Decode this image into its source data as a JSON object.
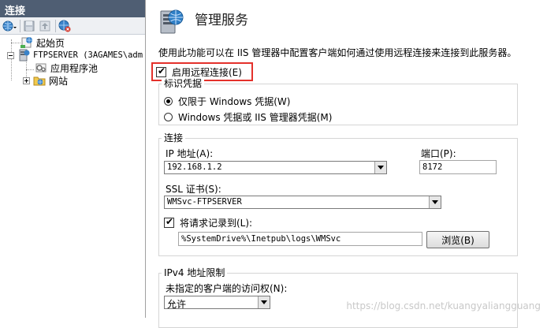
{
  "left": {
    "header": "连接",
    "tree": [
      {
        "label": "起始页"
      },
      {
        "label": "FTPSERVER (3AGAMES\\adm"
      },
      {
        "label": "应用程序池"
      },
      {
        "label": "网站"
      }
    ]
  },
  "main": {
    "title": "管理服务",
    "description": "使用此功能可以在 IIS 管理器中配置客户端如何通过使用远程连接来连接到此服务器。",
    "enable_remote": {
      "label": "启用远程连接(E)",
      "checked": true
    },
    "identity": {
      "title": "标识凭据",
      "options": [
        {
          "label": "仅限于 Windows 凭据(W)",
          "selected": true
        },
        {
          "label": "Windows 凭据或 IIS 管理器凭据(M)",
          "selected": false
        }
      ]
    },
    "connection": {
      "title": "连接",
      "ip_label": "IP 地址(A):",
      "ip_value": "192.168.1.2",
      "port_label": "端口(P):",
      "port_value": "8172",
      "ssl_label": "SSL 证书(S):",
      "ssl_value": "WMSvc-FTPSERVER",
      "log_label": "将请求记录到(L):",
      "log_checked": true,
      "log_path": "%SystemDrive%\\Inetpub\\logs\\WMSvc",
      "browse_label": "浏览(B)"
    },
    "ipv4": {
      "title": "IPv4 地址限制",
      "access_label": "未指定的客户端的访问权(N):",
      "access_value": "允许"
    }
  },
  "watermark": "https://blog.csdn.net/kuangyaliangguang",
  "colors": {
    "header_bg": "#4f5e73",
    "highlight": "#e4312b"
  }
}
